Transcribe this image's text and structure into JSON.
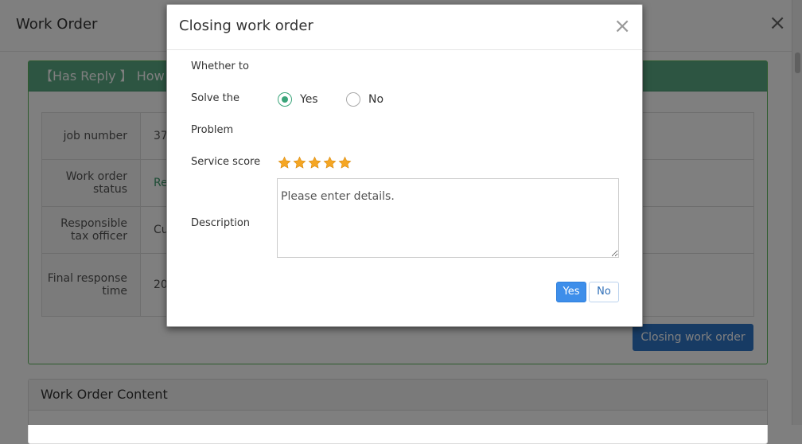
{
  "background": {
    "title": "Work Order",
    "panel_head": "【Has Reply 】 How t",
    "rows": [
      {
        "label": "job number",
        "value": "37"
      },
      {
        "label": "Work order status",
        "value": "Re"
      },
      {
        "label": "Responsible tax officer",
        "value": "Cu"
      },
      {
        "label": "Final response time",
        "value": "20"
      }
    ],
    "close_button": "Closing work order",
    "content_panel_title": "Work Order Content"
  },
  "modal": {
    "title": "Closing work order",
    "labels": {
      "whether_to": "Whether to",
      "solve_the": "Solve the",
      "problem": "Problem",
      "service_score": "Service score",
      "description": "Description"
    },
    "radio": {
      "yes": "Yes",
      "no": "No",
      "selected": "Yes"
    },
    "service_score": 5,
    "description_placeholder": "Please enter details.",
    "description_value": "",
    "buttons": {
      "yes": "Yes",
      "no": "No"
    }
  },
  "colors": {
    "primary_button": "#3d8eea",
    "radio_checked": "#3aa57a",
    "star": "#f5a623",
    "panel_head_green": "#5aaa85"
  }
}
